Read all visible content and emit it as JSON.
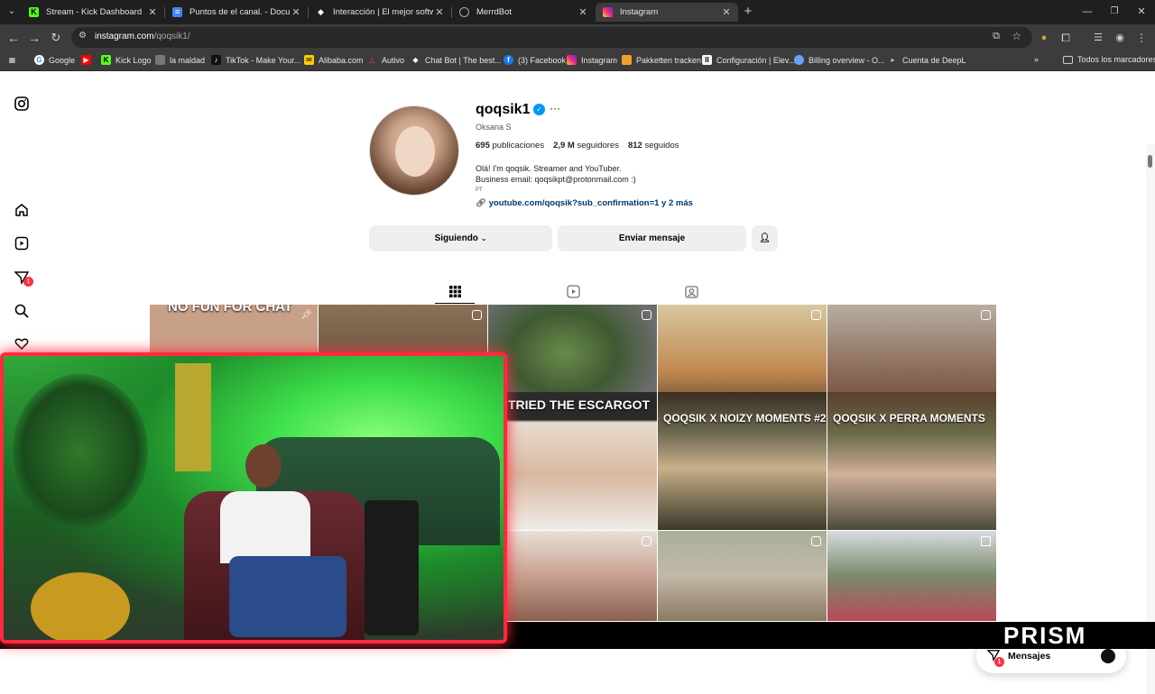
{
  "tabs": [
    {
      "title": "Stream - Kick Dashboard",
      "icon": "kick-icon",
      "color": "#53fc18"
    },
    {
      "title": "Puntos de el canal. - Documento",
      "icon": "docs-icon",
      "color": "#4285f4"
    },
    {
      "title": "Interacción | El mejor software p",
      "icon": "diamond-icon",
      "color": "#ffffff"
    },
    {
      "title": "MerrdBot",
      "icon": "globe-icon",
      "color": "#aaaaaa"
    },
    {
      "title": "Instagram",
      "icon": "instagram-icon",
      "color": "#e1306c"
    }
  ],
  "address": {
    "host": "instagram.com",
    "path": "/qoqsik1/"
  },
  "bookmarks": [
    {
      "label": "Google",
      "color": "#4285f4"
    },
    {
      "label": "",
      "color": "#ff0000"
    },
    {
      "label": "Kick Logo",
      "color": "#53fc18"
    },
    {
      "label": "la maldad",
      "color": "#8a8a8a"
    },
    {
      "label": "TikTok - Make Your...",
      "color": "#111111"
    },
    {
      "label": "Alibaba.com",
      "color": "#ff6a00"
    },
    {
      "label": "Autivo",
      "color": "#e74c3c"
    },
    {
      "label": "Chat Bot | The best...",
      "color": "#ffffff"
    },
    {
      "label": "(3) Facebook",
      "color": "#1877f2"
    },
    {
      "label": "Instagram",
      "color": "#e1306c"
    },
    {
      "label": "Pakketten tracken",
      "color": "#f0a030"
    },
    {
      "label": "Configuración | Elev...",
      "color": "#f5f5f5"
    },
    {
      "label": "Billing overview - O...",
      "color": "#6aa0ff"
    },
    {
      "label": "Cuenta de DeepL",
      "color": "#0f2b46"
    }
  ],
  "bookmarks_all": "Todos los marcadores",
  "profile": {
    "username": "qoqsik1",
    "fullname": "Oksana S",
    "posts_count": "695",
    "posts_label": "publicaciones",
    "followers_count": "2,9 M",
    "followers_label": "seguidores",
    "following_count": "812",
    "following_label": "seguidos",
    "bio_line1": "Olá! I'm qoqsik. Streamer and YouTuber.",
    "bio_line2": "Business email: qoqsikpt@protonmail.com :)",
    "bio_line3": "PT",
    "link": "youtube.com/qoqsik?sub_confirmation=1 y 2 más"
  },
  "buttons": {
    "following": "Siguiendo",
    "message": "Enviar mensaje"
  },
  "posts": [
    {
      "caption": "NO FUN FOR CHAT",
      "bg": "#c8a088"
    },
    {
      "caption": "",
      "bg": "#8a7056"
    },
    {
      "caption": "",
      "bg": "#3f5a33"
    },
    {
      "caption": "",
      "bg": "#c8a060"
    },
    {
      "caption": "",
      "bg": "#a09080"
    },
    {
      "caption": "TRIED THE ESCARGOT",
      "bg": "#e8dcd0"
    },
    {
      "caption": "QOQSIK X NOIZY MOMENTS #2",
      "bg": "#6e6a52"
    },
    {
      "caption": "QOQSIK X PERRA MOMENTS",
      "bg": "#6a6a48"
    },
    {
      "caption": "",
      "bg": "#d6c4bc"
    },
    {
      "caption": "",
      "bg": "#c2b8a8"
    },
    {
      "caption": "",
      "bg": "#7a8a6a"
    }
  ],
  "messages": {
    "label": "Mensajes",
    "badge": "1"
  },
  "nav_badge": "1",
  "overlay_brand": "PRISM"
}
